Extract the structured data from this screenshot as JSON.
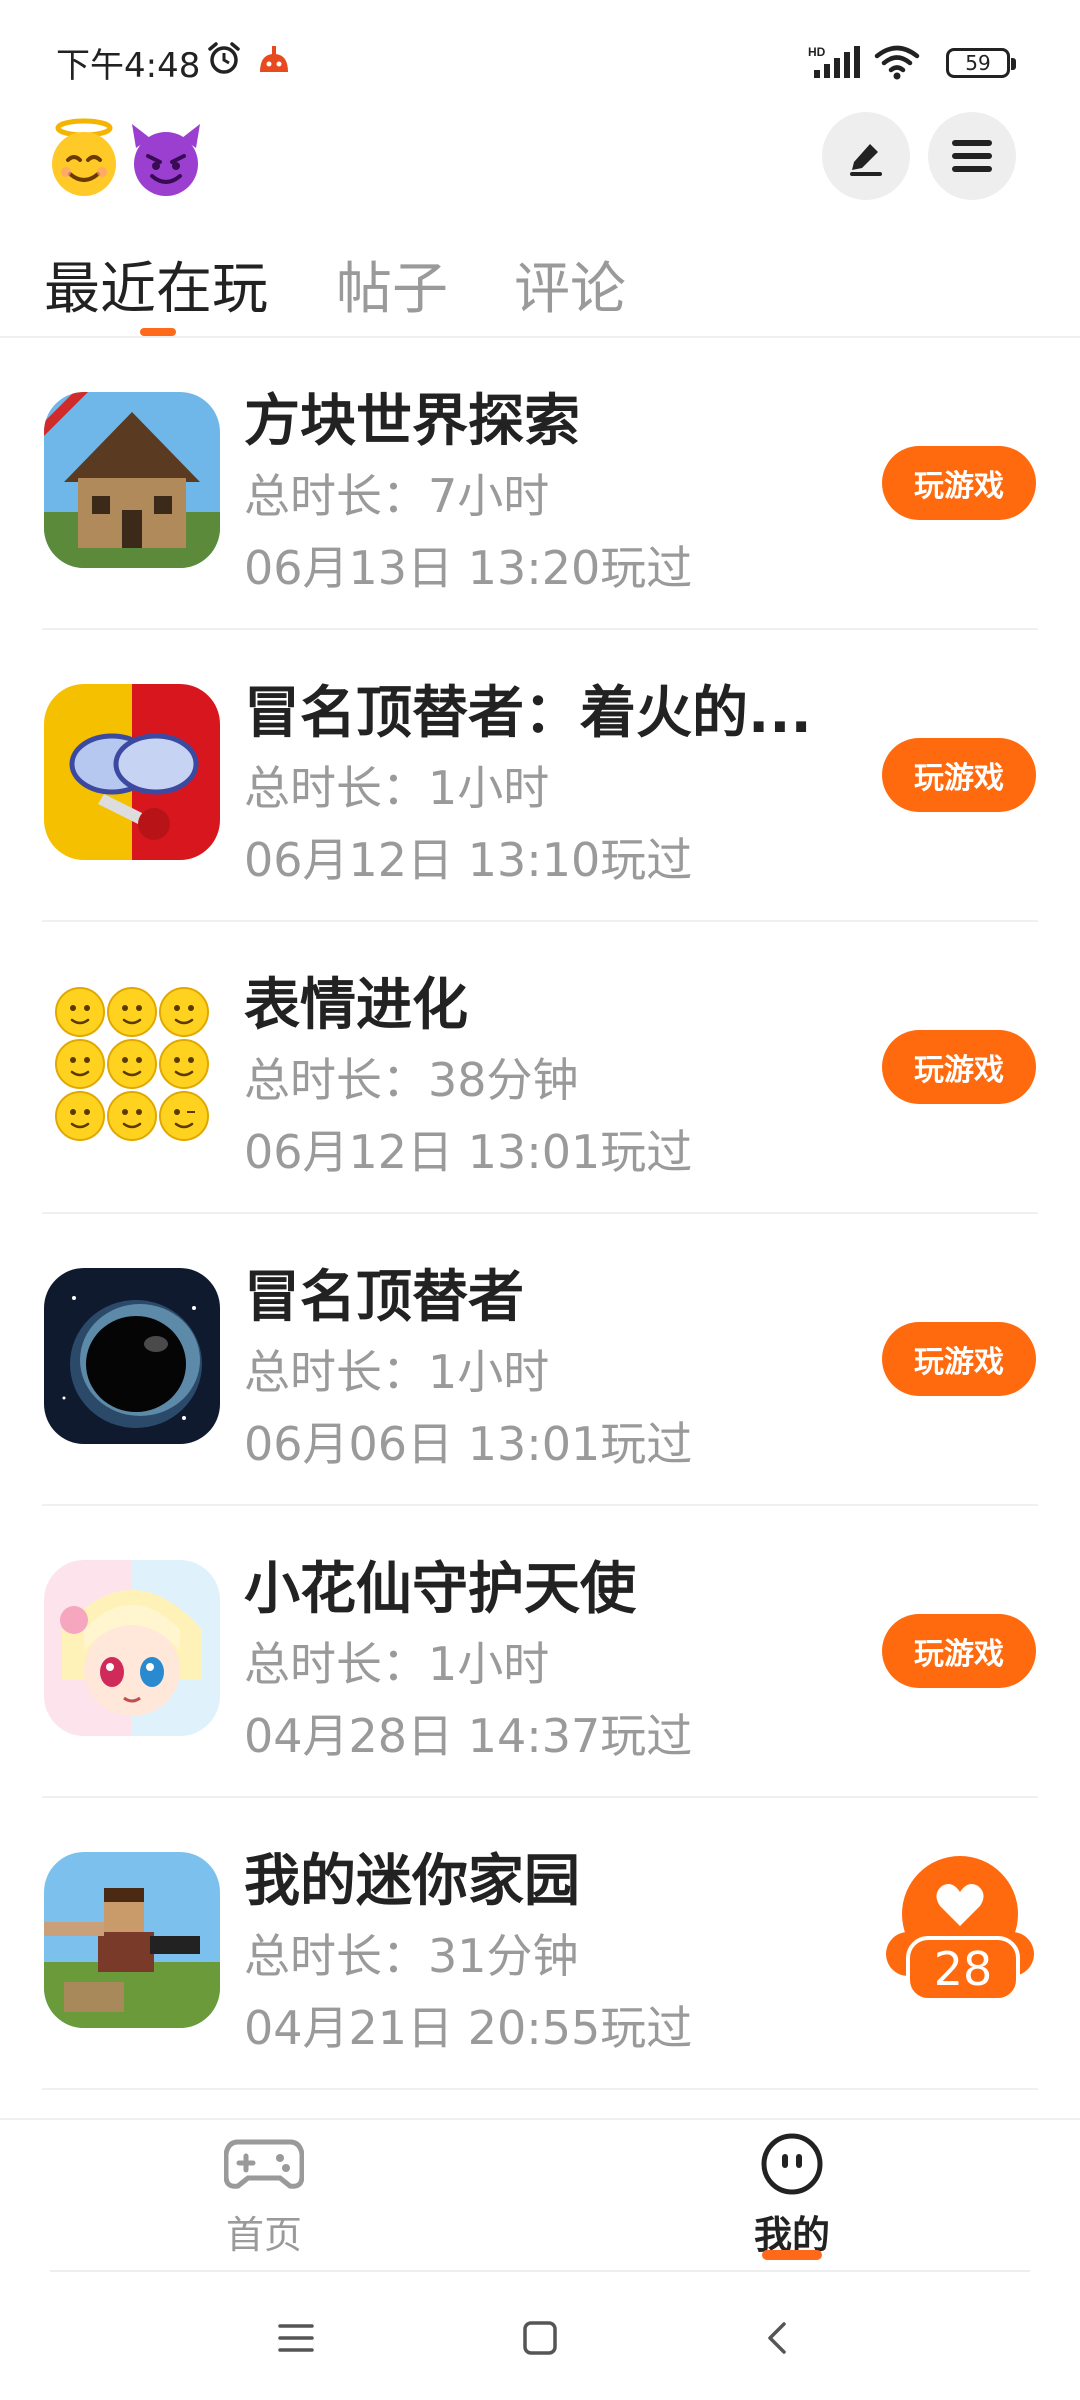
{
  "status_bar": {
    "time": "下午4:48",
    "network_label": "HD",
    "battery": "59"
  },
  "header": {
    "avatar_emojis": [
      "😇",
      "😈"
    ],
    "edit_icon": "pen-icon",
    "menu_icon": "hamburger-icon"
  },
  "tabs": [
    {
      "label": "最近在玩",
      "active": true
    },
    {
      "label": "帖子",
      "active": false
    },
    {
      "label": "评论",
      "active": false
    }
  ],
  "games": [
    {
      "title": "方块世界探索",
      "duration": "总时长：7小时",
      "last_played": "06月13日 13:20玩过",
      "button": "玩游戏"
    },
    {
      "title": "冒名顶替者：着火的...",
      "duration": "总时长：1小时",
      "last_played": "06月12日 13:10玩过",
      "button": "玩游戏"
    },
    {
      "title": "表情进化",
      "duration": "总时长：38分钟",
      "last_played": "06月12日 13:01玩过",
      "button": "玩游戏"
    },
    {
      "title": "冒名顶替者",
      "duration": "总时长：1小时",
      "last_played": "06月06日 13:01玩过",
      "button": "玩游戏"
    },
    {
      "title": "小花仙守护天使",
      "duration": "总时长：1小时",
      "last_played": "04月28日 14:37玩过",
      "button": "玩游戏"
    },
    {
      "title": "我的迷你家园",
      "duration": "总时长：31分钟",
      "last_played": "04月21日 20:55玩过",
      "button": ""
    }
  ],
  "like_badge": {
    "count": "28",
    "icon": "heart-icon"
  },
  "bottom_nav": [
    {
      "label": "首页",
      "icon": "gamepad-icon",
      "active": false
    },
    {
      "label": "我的",
      "icon": "face-icon",
      "active": true
    }
  ],
  "colors": {
    "accent": "#ff6a0f",
    "text_primary": "#222222",
    "text_secondary": "#9a9a9a"
  }
}
